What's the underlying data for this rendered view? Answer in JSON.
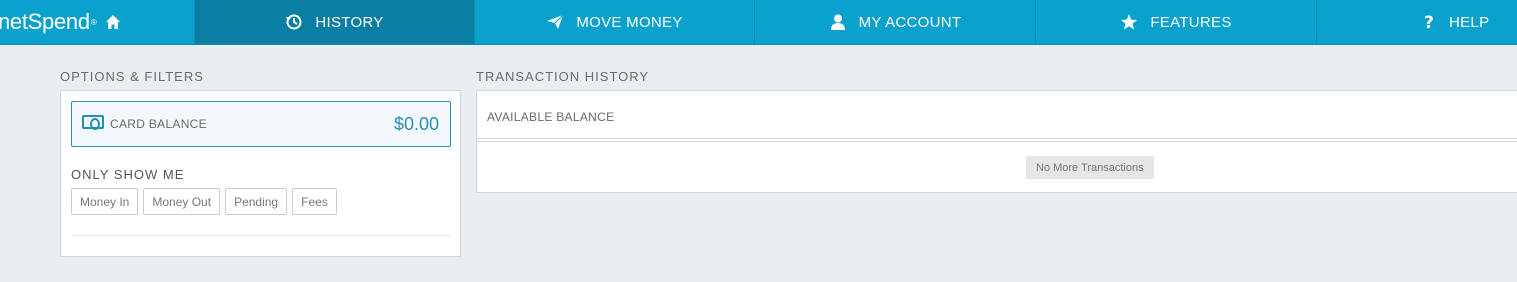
{
  "brand": {
    "name": "netSpend",
    "reg_mark": "®"
  },
  "nav": {
    "items": [
      {
        "label": "HISTORY",
        "icon": "history-icon",
        "active": true
      },
      {
        "label": "MOVE MONEY",
        "icon": "paper-plane-icon",
        "active": false
      },
      {
        "label": "MY ACCOUNT",
        "icon": "user-icon",
        "active": false
      },
      {
        "label": "FEATURES",
        "icon": "star-icon",
        "active": false
      },
      {
        "label": "HELP",
        "icon": "question-icon",
        "active": false
      }
    ]
  },
  "filters": {
    "title": "OPTIONS & FILTERS",
    "card_balance": {
      "label": "CARD BALANCE",
      "amount": "$0.00",
      "icon": "money-icon"
    },
    "only_show_label": "ONLY SHOW ME",
    "buttons": [
      "Money In",
      "Money Out",
      "Pending",
      "Fees"
    ]
  },
  "transactions": {
    "title": "TRANSACTION HISTORY",
    "available_balance_label": "AVAILABLE BALANCE",
    "empty_message": "No More Transactions"
  },
  "colors": {
    "nav_bg": "#0aa2cd",
    "nav_active": "#0a7fa3",
    "accent": "#2b8fb3",
    "page_bg": "#e9eef0"
  }
}
